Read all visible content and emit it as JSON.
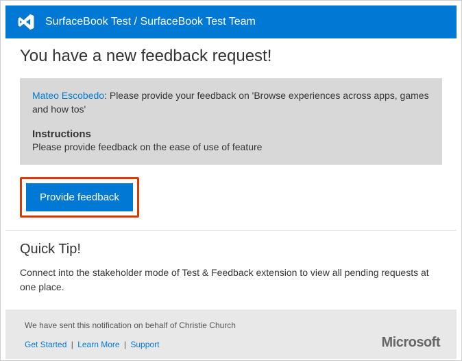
{
  "header": {
    "title": "SurfaceBook Test / SurfaceBook Test Team"
  },
  "page": {
    "title": "You have a new feedback request!"
  },
  "request": {
    "sender": "Mateo Escobedo",
    "message": ": Please provide your feedback on 'Browse experiences across  apps, games and how tos'",
    "instructions_label": "Instructions",
    "instructions_text": "Please provide feedback on the ease of use of feature"
  },
  "actions": {
    "provide_feedback": "Provide feedback"
  },
  "tip": {
    "title": "Quick Tip!",
    "text": "Connect into the stakeholder mode of Test & Feedback extension to view all pending requests at one place."
  },
  "footer": {
    "note_prefix": "We have sent this notification on behalf of ",
    "on_behalf_of": "Christie Church",
    "links": {
      "get_started": "Get Started",
      "learn_more": "Learn More",
      "support": "Support"
    },
    "brand": "Microsoft"
  }
}
